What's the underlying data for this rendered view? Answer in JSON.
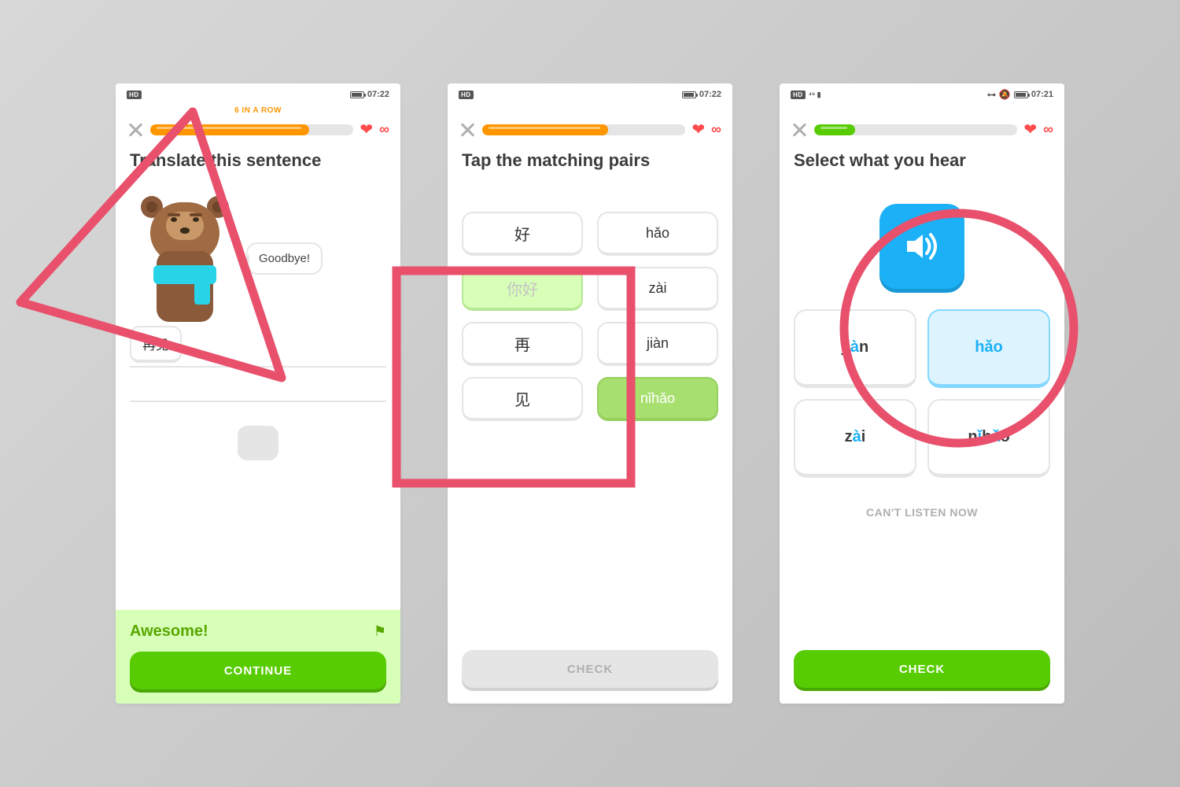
{
  "screen1": {
    "status_time": "07:22",
    "streak_label": "6 IN A ROW",
    "title": "Translate this sentence",
    "speech": "Goodbye!",
    "answer_chip": "再见",
    "feedback_title": "Awesome!",
    "continue_label": "CONTINUE",
    "progress_pct": 78,
    "progress_color": "#ff9600"
  },
  "screen2": {
    "status_time": "07:22",
    "title": "Tap the matching pairs",
    "left": [
      "好",
      "你好",
      "再",
      "见"
    ],
    "right": [
      "hǎo",
      "zài",
      "jiàn",
      "nǐhǎo"
    ],
    "check_label": "CHECK",
    "progress_pct": 62,
    "progress_color": "#ff9600"
  },
  "screen3": {
    "status_time": "07:21",
    "title": "Select what you hear",
    "choices": [
      "jiàn",
      "hǎo",
      "zài",
      "nǐhǎo"
    ],
    "cant_listen": "CAN'T LISTEN NOW",
    "check_label": "CHECK",
    "progress_pct": 20,
    "progress_color": "#58cc02"
  }
}
